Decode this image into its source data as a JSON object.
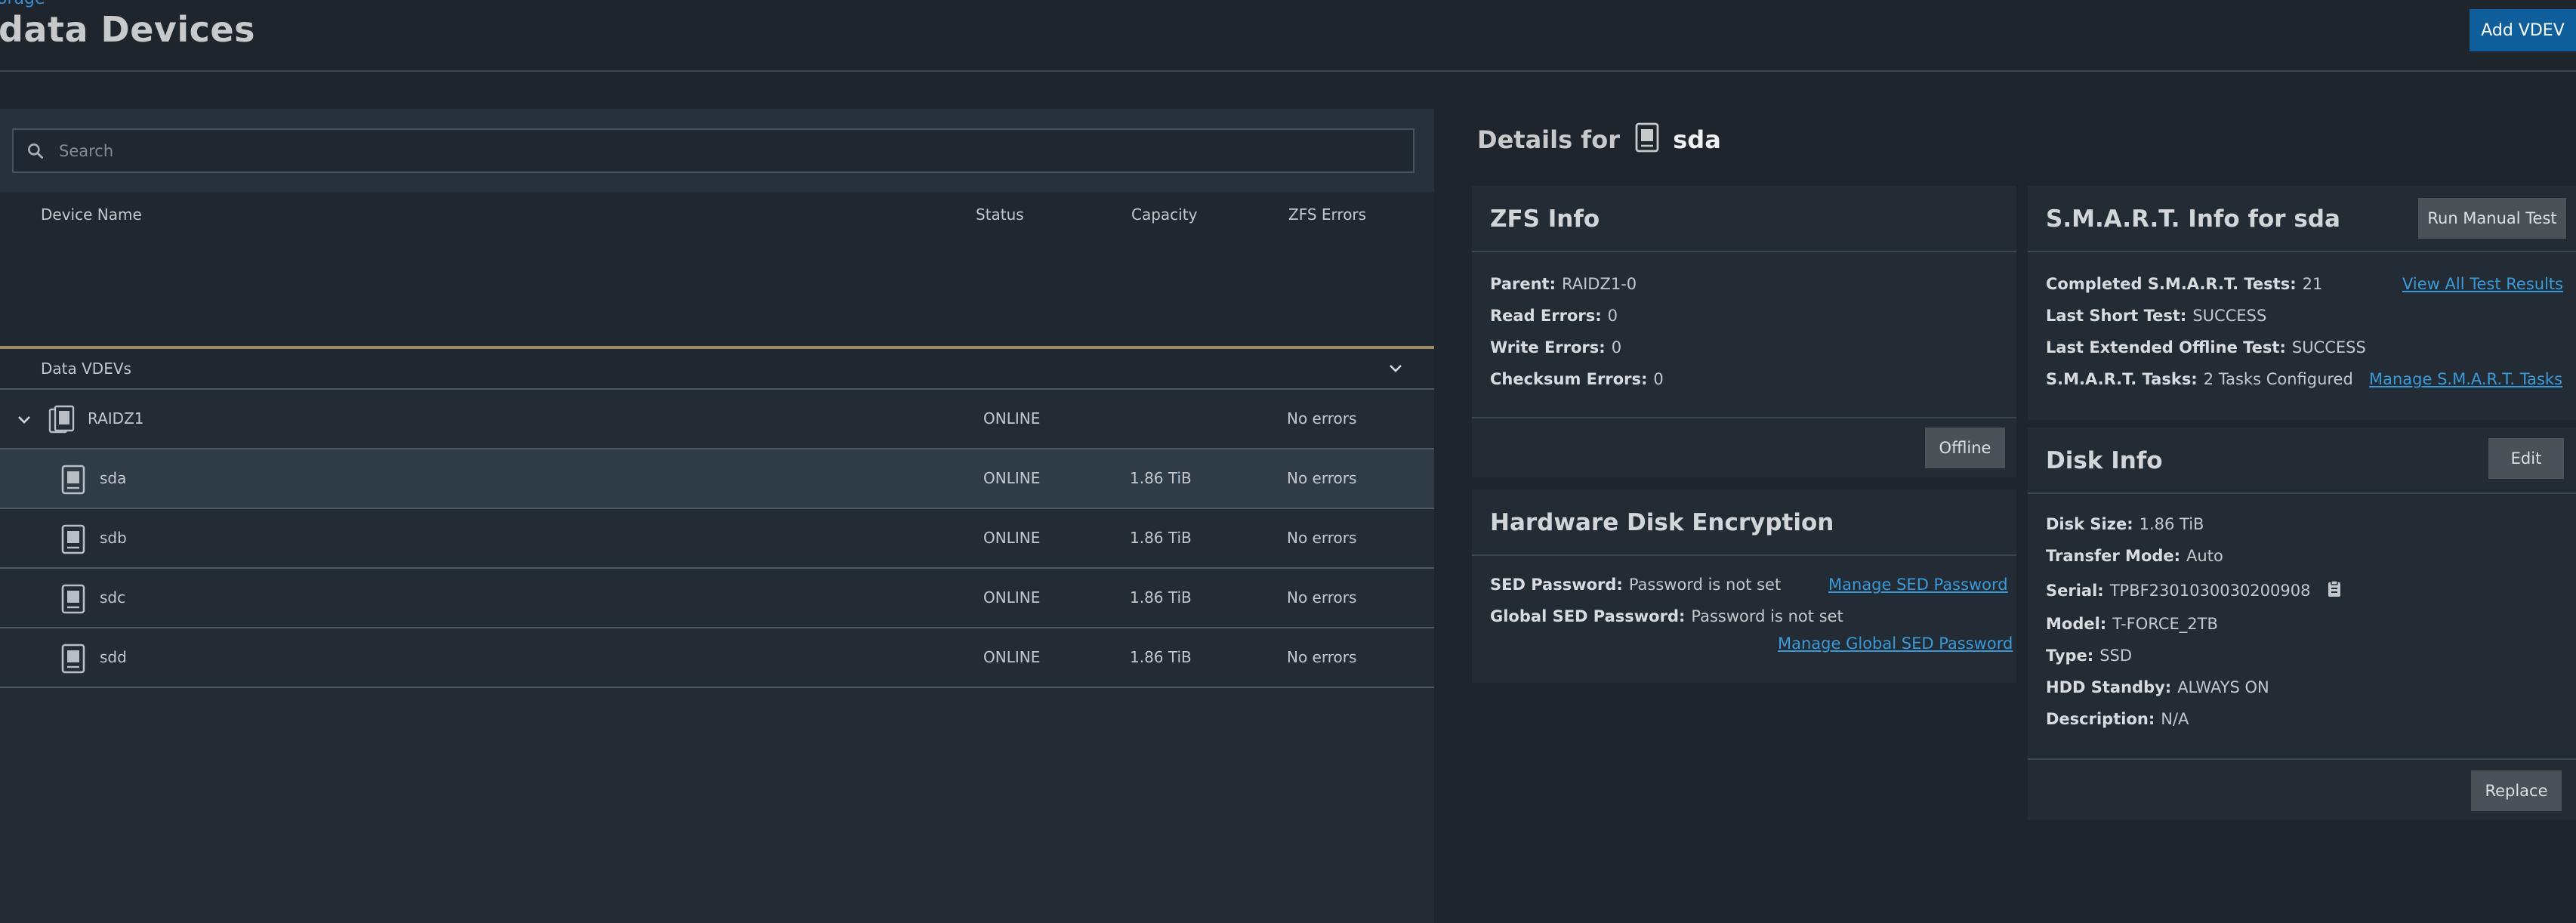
{
  "header": {
    "breadcrumb": "orage",
    "title": "data Devices",
    "add_vdev_label": "Add VDEV"
  },
  "search": {
    "placeholder": "Search"
  },
  "table": {
    "columns": [
      "Device Name",
      "Status",
      "Capacity",
      "ZFS Errors"
    ],
    "group_label": "Data VDEVs",
    "vdev": {
      "name": "RAIDZ1",
      "status": "ONLINE",
      "capacity": "",
      "errors": "No errors"
    },
    "disks": [
      {
        "name": "sda",
        "status": "ONLINE",
        "capacity": "1.86 TiB",
        "errors": "No errors"
      },
      {
        "name": "sdb",
        "status": "ONLINE",
        "capacity": "1.86 TiB",
        "errors": "No errors"
      },
      {
        "name": "sdc",
        "status": "ONLINE",
        "capacity": "1.86 TiB",
        "errors": "No errors"
      },
      {
        "name": "sdd",
        "status": "ONLINE",
        "capacity": "1.86 TiB",
        "errors": "No errors"
      }
    ]
  },
  "details": {
    "prefix": "Details for",
    "disk": "sda"
  },
  "zfs_info": {
    "title": "ZFS Info",
    "parent_key": "Parent:",
    "parent_val": "RAIDZ1-0",
    "read_key": "Read Errors:",
    "read_val": "0",
    "write_key": "Write Errors:",
    "write_val": "0",
    "checksum_key": "Checksum Errors:",
    "checksum_val": "0",
    "offline_label": "Offline"
  },
  "encryption": {
    "title": "Hardware Disk Encryption",
    "sed_key": "SED Password:",
    "sed_val": "Password is not set",
    "global_key": "Global SED Password:",
    "global_val": "Password is not set",
    "manage_sed": "Manage SED Password",
    "manage_global": "Manage Global SED Password"
  },
  "smart": {
    "title": "S.M.A.R.T. Info for sda",
    "run_label": "Run Manual Test",
    "completed_key": "Completed S.M.A.R.T. Tests:",
    "completed_val": "21",
    "short_key": "Last Short Test:",
    "short_val": "SUCCESS",
    "extended_key": "Last Extended Offline Test:",
    "extended_val": "SUCCESS",
    "tasks_key": "S.M.A.R.T. Tasks:",
    "tasks_val": "2 Tasks Configured",
    "view_all": "View All Test Results",
    "manage_tasks": "Manage S.M.A.R.T. Tasks"
  },
  "disk_info": {
    "title": "Disk Info",
    "edit_label": "Edit",
    "size_key": "Disk Size:",
    "size_val": "1.86 TiB",
    "transfer_key": "Transfer Mode:",
    "transfer_val": "Auto",
    "serial_key": "Serial:",
    "serial_val": "TPBF2301030030200908",
    "model_key": "Model:",
    "model_val": "T-FORCE_2TB",
    "type_key": "Type:",
    "type_val": "SSD",
    "standby_key": "HDD Standby:",
    "standby_val": "ALWAYS ON",
    "desc_key": "Description:",
    "desc_val": "N/A",
    "replace_label": "Replace"
  },
  "icons": {
    "search": "search-icon",
    "chevron": "chevron-down-icon",
    "disk": "disk-icon",
    "vdev": "vdev-icon",
    "copy": "clipboard-icon"
  },
  "colors": {
    "accent": "#0e5f9c",
    "link": "#3a9ad9",
    "divider_gold": "#9d8a66"
  }
}
